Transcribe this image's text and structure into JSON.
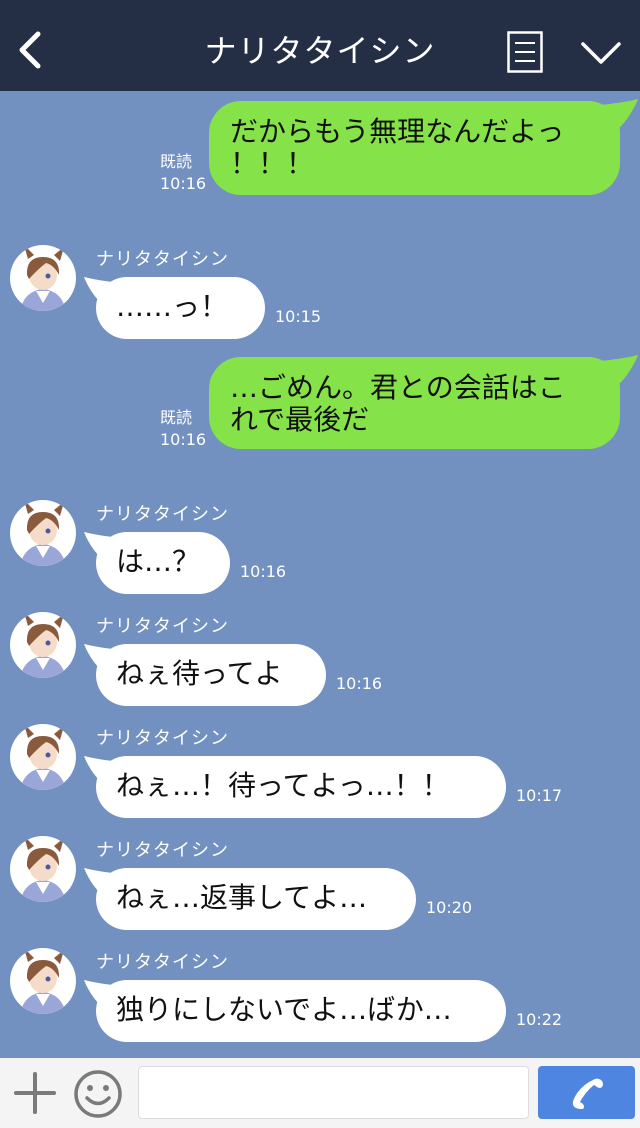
{
  "header": {
    "title": "ナリタタイシン",
    "back_icon": "chevron-left-icon",
    "menu_icon": "notes-icon",
    "collapse_icon": "chevron-down-icon"
  },
  "colors": {
    "header_bg": "#242f46",
    "chat_bg": "#7291c0",
    "outgoing_bubble": "#86e249",
    "incoming_bubble": "#ffffff",
    "call_button": "#4e85e0"
  },
  "messages": [
    {
      "dir": "out",
      "lines": [
        "だからもう無理なんだよっ",
        "！！！"
      ],
      "read": "既読",
      "time": "10:16"
    },
    {
      "dir": "in",
      "sender": "ナリタタイシン",
      "text": "……っ！",
      "time": "10:15"
    },
    {
      "dir": "out",
      "lines": [
        "…ごめん。君との会話はこ",
        "れで最後だ"
      ],
      "read": "既読",
      "time": "10:16"
    },
    {
      "dir": "in",
      "sender": "ナリタタイシン",
      "text": "は…？",
      "time": "10:16"
    },
    {
      "dir": "in",
      "sender": "ナリタタイシン",
      "text": "ねぇ待ってよ",
      "time": "10:16"
    },
    {
      "dir": "in",
      "sender": "ナリタタイシン",
      "text": "ねぇ…！待ってよっ…！！",
      "time": "10:17"
    },
    {
      "dir": "in",
      "sender": "ナリタタイシン",
      "text": "ねぇ…返事してよ…",
      "time": "10:20"
    },
    {
      "dir": "in",
      "sender": "ナリタタイシン",
      "text": "独りにしないでよ…ばか…",
      "time": "10:22"
    }
  ],
  "footer": {
    "add_icon": "plus-icon",
    "emoji_icon": "smiley-icon",
    "input_placeholder": "",
    "call_icon": "phone-icon"
  }
}
